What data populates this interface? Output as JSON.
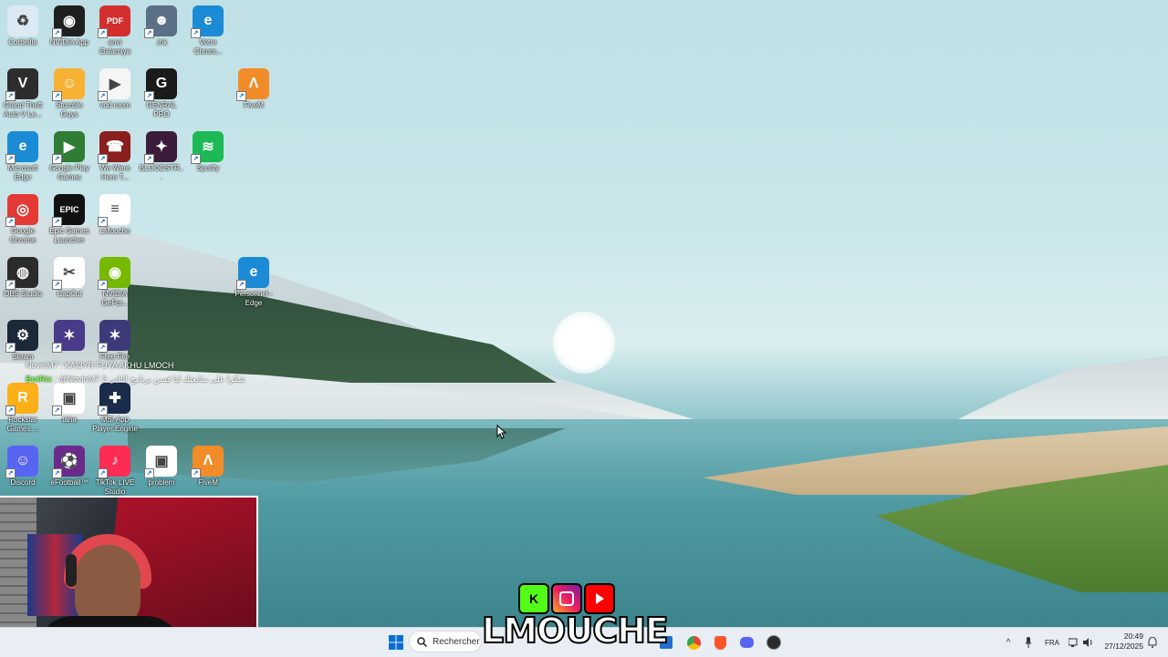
{
  "desktop": {
    "icons": [
      {
        "label": "Corbeille",
        "icon": "recycle-bin-icon",
        "color": "#dbe9f5",
        "glyph": "♻"
      },
      {
        "label": "NVIDIA App",
        "icon": "nvidia-icon",
        "color": "#1f1f1f",
        "glyph": "◉"
      },
      {
        "label": "anvi l3alamiya",
        "icon": "pdf-icon",
        "color": "#d32f2f",
        "glyph": "PDF"
      },
      {
        "label": ".lnk",
        "icon": "game-character-icon",
        "color": "#5b6f86",
        "glyph": "☻"
      },
      {
        "label": "Votre Chrom...",
        "icon": "edge-icon",
        "color": "#1b8bd6",
        "glyph": "e"
      },
      {
        "label": "Grand Theft Auto V Le...",
        "icon": "gta-icon",
        "color": "#2d2d2d",
        "glyph": "V"
      },
      {
        "label": "Stumble Guys",
        "icon": "stumble-guys-icon",
        "color": "#f7b234",
        "glyph": "☺"
      },
      {
        "label": "vod room",
        "icon": "video-file-icon",
        "color": "#f5f5f5",
        "glyph": "▶"
      },
      {
        "label": "GENRAL PRO",
        "icon": "general-pro-icon",
        "color": "#1a1a1a",
        "glyph": "G"
      },
      {
        "label": "FiveM",
        "icon": "fivem-icon",
        "color": "#f28c28",
        "glyph": "Λ"
      },
      {
        "label": "Microsoft Edge",
        "icon": "edge-icon",
        "color": "#1b8bd6",
        "glyph": "e"
      },
      {
        "label": "Google Play Games",
        "icon": "play-games-icon",
        "color": "#2e7d32",
        "glyph": "▶"
      },
      {
        "label": "We Were Here T...",
        "icon": "walkie-talkie-icon",
        "color": "#8b1e1e",
        "glyph": "☎"
      },
      {
        "label": "BLOODSTR...",
        "icon": "bloodstrike-icon",
        "color": "#3b1d3b",
        "glyph": "✦"
      },
      {
        "label": "Spotify",
        "icon": "spotify-icon",
        "color": "#1db954",
        "glyph": "≋"
      },
      {
        "label": "Google Chrome",
        "icon": "chrome-icon",
        "color": "#e53935",
        "glyph": "◎"
      },
      {
        "label": "Epic Games Launcher",
        "icon": "epic-games-icon",
        "color": "#111111",
        "glyph": "EPIC"
      },
      {
        "label": "LMouche",
        "icon": "text-file-icon",
        "color": "#ffffff",
        "glyph": "≡"
      },
      {
        "label": "OBS Studio",
        "icon": "obs-icon",
        "color": "#2b2b2b",
        "glyph": "◍"
      },
      {
        "label": "CapCut",
        "icon": "capcut-icon",
        "color": "#ffffff",
        "glyph": "✂"
      },
      {
        "label": "NVIDIA GeFor...",
        "icon": "nvidia-geforce-icon",
        "color": "#76b900",
        "glyph": "◉"
      },
      {
        "label": "Personnel - Edge",
        "icon": "edge-icon",
        "color": "#1b8bd6",
        "glyph": "e"
      },
      {
        "label": "Steam",
        "icon": "steam-icon",
        "color": "#1b2838",
        "glyph": "⚙"
      },
      {
        "label": "",
        "icon": "game-icon",
        "color": "#4a3a8a",
        "glyph": "✶"
      },
      {
        "label": "Free Fire",
        "icon": "free-fire-icon",
        "color": "#3d3a7a",
        "glyph": "✶"
      },
      {
        "label": "Rockstar Games ...",
        "icon": "rockstar-icon",
        "color": "#fcaf17",
        "glyph": "R"
      },
      {
        "label": "taha",
        "icon": "image-file-icon",
        "color": "#ffffff",
        "glyph": "▣"
      },
      {
        "label": "MSI App Player Engine",
        "icon": "msi-app-player-icon",
        "color": "#1b2b4a",
        "glyph": "✚"
      },
      {
        "label": "Discord",
        "icon": "discord-icon",
        "color": "#5865f2",
        "glyph": "☺"
      },
      {
        "label": "eFootball™",
        "icon": "efootball-icon",
        "color": "#6a2a8a",
        "glyph": "⚽"
      },
      {
        "label": "TikTok LIVE Studio",
        "icon": "tiktok-icon",
        "color": "#fe2c55",
        "glyph": "♪"
      },
      {
        "label": "problem",
        "icon": "image-file-icon",
        "color": "#ffffff",
        "glyph": "▣"
      },
      {
        "label": "FiveM",
        "icon": "fivem-icon",
        "color": "#f28c28",
        "glyph": "Λ"
      }
    ]
  },
  "chat": {
    "line1": "NovinM7 : KAI3YR FUYA AKHU LMOCH",
    "line2_user": "BotRix",
    "line2_text": ": @NovinM7 2 شكرا على متابعتك لنا فسن برنامج الثاني"
  },
  "overlay": {
    "brand": "LMOUCHE",
    "kick_letter": "K"
  },
  "taskbar": {
    "search_placeholder": "Rechercher",
    "language": "FRA",
    "time": "20:49",
    "date": "27/12/2025"
  },
  "colors": {
    "taskbar_bg": "#e8eef3",
    "kick": "#53fc18",
    "youtube": "#ff0000"
  }
}
